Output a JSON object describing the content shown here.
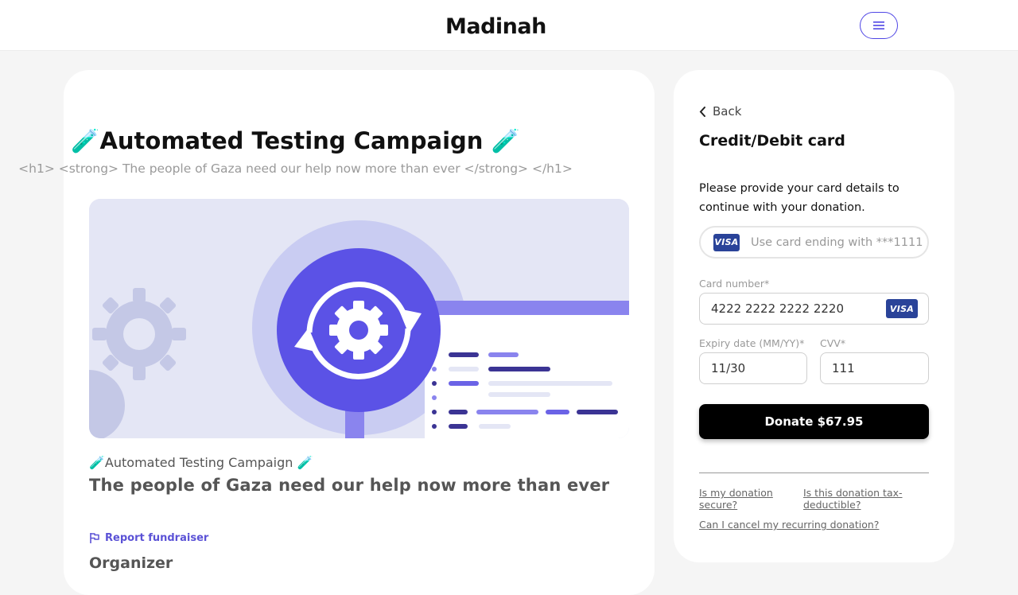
{
  "header": {
    "logo_text": "Madinah",
    "menu_icon": "hamburger-icon",
    "accent": "#4f46e5"
  },
  "campaign": {
    "title": "🧪Automated Testing Campaign 🧪",
    "subtitle": "<h1> <strong> The people of Gaza need our help now more than ever </strong> </h1>",
    "small_title": "🧪Automated Testing Campaign 🧪",
    "headline": "The people of Gaza need our help now more than ever",
    "report_label": "Report fundraiser",
    "report_icon": "flag-icon",
    "organizer_heading": "Organizer"
  },
  "payment": {
    "back_label": "Back",
    "back_icon": "chevron-left-icon",
    "title": "Credit/Debit card",
    "description": "Please provide your card details to continue with your donation.",
    "saved_card_text": "Use card ending with ***1111",
    "card_brand": "VISA",
    "card_number_label": "Card number*",
    "card_number_value": "4222 2222 2222 2220",
    "expiry_label": "Expiry date (MM/YY)*",
    "expiry_value": "11/30",
    "cvv_label": "CVV*",
    "cvv_value": "111",
    "donate_label": "Donate $67.95",
    "faq": [
      "Is my donation secure?",
      "Is this donation tax-deductible?",
      "Can I cancel my recurring donation?"
    ]
  }
}
